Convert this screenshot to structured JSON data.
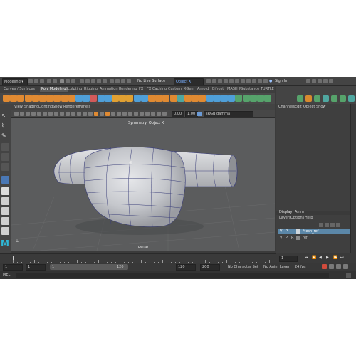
{
  "statusline": {
    "mode_menu": "Modeling",
    "live_surface": "No Live Surface",
    "symmetry_field": "Object X",
    "sign_in": "Sign In"
  },
  "shelf_tabs": [
    "Curves / Surfaces",
    "Poly Modeling",
    "Sculpting",
    "Rigging",
    "Animation",
    "Rendering",
    "FX",
    "FX Caching",
    "Custom",
    "XGen",
    "Arnold",
    "Bifrost",
    "MASH",
    "Motion Graphics",
    "Substance",
    "TURTLE"
  ],
  "active_shelf_tab": "Poly Modeling",
  "viewport": {
    "menu": [
      "View",
      "Shading",
      "Lighting",
      "Show",
      "Renderer",
      "Panels"
    ],
    "field_a": "0.00",
    "field_b": "1.00",
    "color_space": "sRGB gamma",
    "symmetry_label": "Symmetry: Object X",
    "camera_label": "persp"
  },
  "channel_box": {
    "tabs": [
      "Channels",
      "Edit",
      "Object",
      "Show"
    ]
  },
  "layer_editor": {
    "tabs": [
      "Display",
      "Anim"
    ],
    "menu": [
      "Layers",
      "Options",
      "Help"
    ],
    "layers": [
      {
        "v": "V",
        "p": "P",
        "r": "",
        "name": "Mesh_ref",
        "selected": true
      },
      {
        "v": "V",
        "p": "P",
        "r": "R",
        "name": "ref",
        "selected": false
      }
    ]
  },
  "time_slider": {
    "start": "1",
    "start_inner": "1",
    "end_inner": "120",
    "end": "120",
    "end_outer": "200",
    "fps": "24 fps",
    "character_set": "No Character Set",
    "anim_layer": "No Anim Layer",
    "current_frame": "1"
  },
  "command_line": {
    "lang": "MEL"
  },
  "colors": {
    "shell": "#3b3b3b",
    "viewport": "#5b5c5d",
    "active_tab": "#5a5a5a",
    "selected_layer": "#5b87a8",
    "mesh_wire": "#3b3f7a"
  },
  "shelf_icons": [
    "sphere-icon",
    "cube-icon",
    "cylinder-icon",
    "cone-icon",
    "torus-icon",
    "plane-icon",
    "disc-icon",
    "platonic-icon",
    "sweep-icon",
    "superellipse-icon",
    "combine-icon",
    "separate-icon",
    "smooth-icon",
    "mirror-icon",
    "boolean-icon",
    "extrude-icon",
    "bridge-icon",
    "bevel-icon",
    "fill-hole-icon",
    "append-icon",
    "multicut-icon",
    "target-weld-icon",
    "insert-loop-icon",
    "offset-loop-icon",
    "quad-draw-icon",
    "poke-icon",
    "wedge-icon",
    "collapse-icon",
    "merge-icon",
    "circularize-icon",
    "crease-icon",
    "slide-icon",
    "uv-editor-icon",
    "planar-uv-icon",
    "auto-uv-icon",
    "cut-uv-icon",
    "sew-uv-icon"
  ]
}
